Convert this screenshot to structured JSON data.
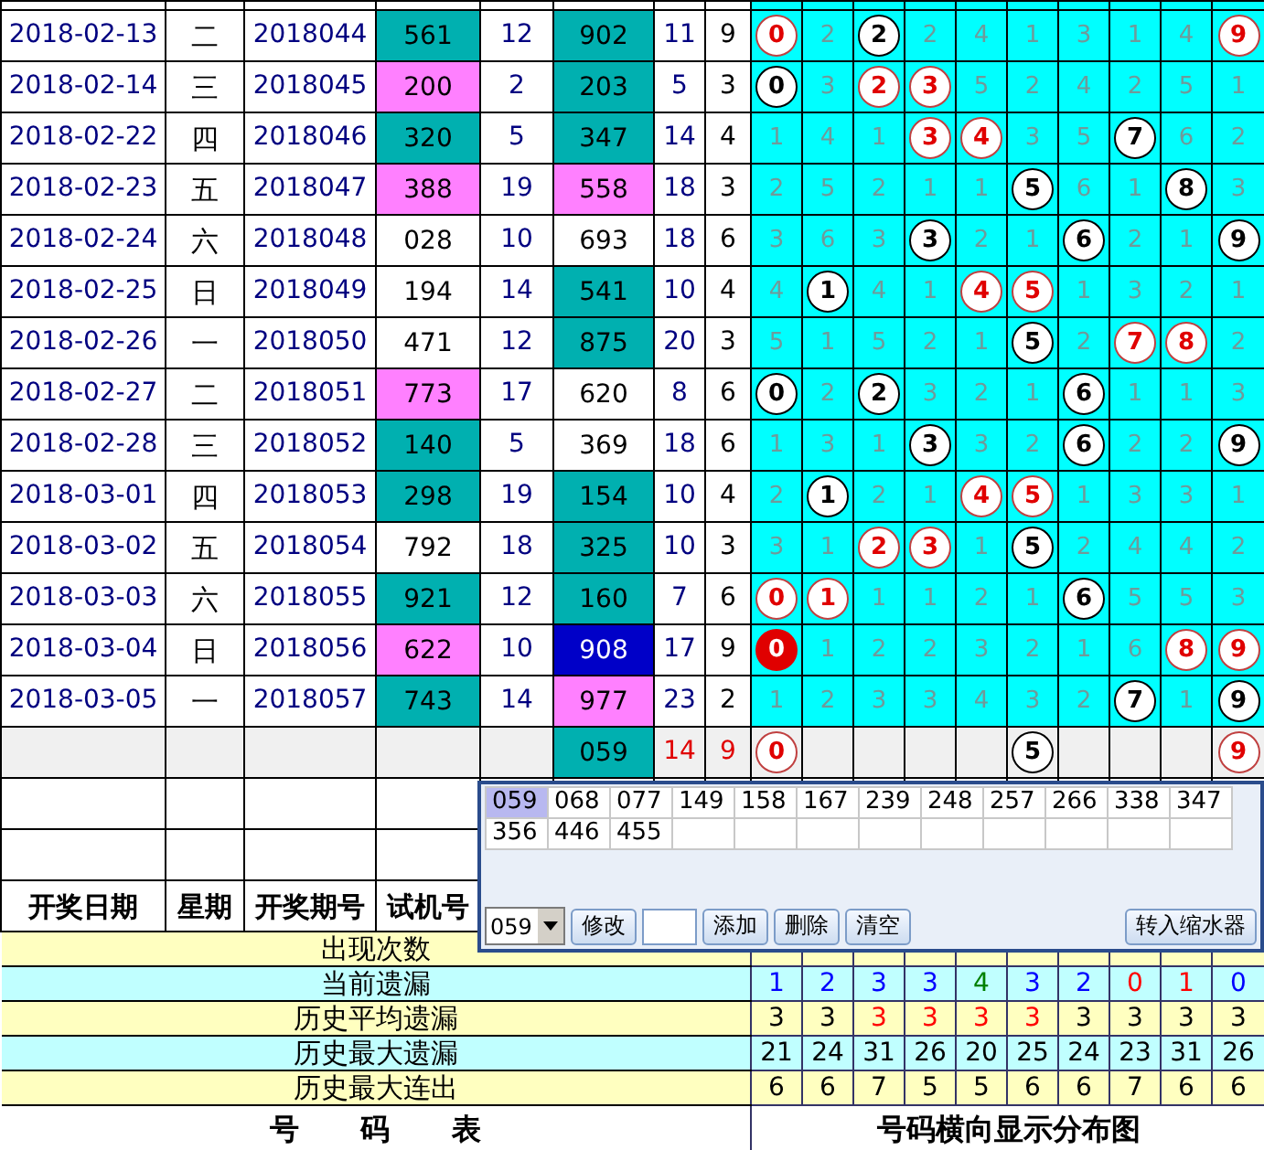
{
  "rows": [
    {
      "date": "2018-02-13",
      "weekday": "二",
      "issue": "2018044",
      "trial": {
        "text": "561",
        "color": "#00b0b0"
      },
      "trial_sum": "12",
      "result": {
        "text": "902",
        "color": "#00b0b0",
        "selected": false
      },
      "result_sum": "11",
      "span": "9",
      "cells": [
        {
          "text": "0",
          "kind": "hot"
        },
        {
          "text": "2",
          "kind": "miss"
        },
        {
          "text": "2",
          "kind": "hit"
        },
        {
          "text": "2",
          "kind": "miss"
        },
        {
          "text": "4",
          "kind": "miss"
        },
        {
          "text": "1",
          "kind": "miss"
        },
        {
          "text": "3",
          "kind": "miss"
        },
        {
          "text": "1",
          "kind": "miss"
        },
        {
          "text": "4",
          "kind": "miss"
        },
        {
          "text": "9",
          "kind": "hot"
        }
      ]
    },
    {
      "date": "2018-02-14",
      "weekday": "三",
      "issue": "2018045",
      "trial": {
        "text": "200",
        "color": "#ff80ff"
      },
      "trial_sum": "2",
      "result": {
        "text": "203",
        "color": "#00b0b0",
        "selected": false
      },
      "result_sum": "5",
      "span": "3",
      "cells": [
        {
          "text": "0",
          "kind": "hit"
        },
        {
          "text": "3",
          "kind": "miss"
        },
        {
          "text": "2",
          "kind": "hot"
        },
        {
          "text": "3",
          "kind": "hot"
        },
        {
          "text": "5",
          "kind": "miss"
        },
        {
          "text": "2",
          "kind": "miss"
        },
        {
          "text": "4",
          "kind": "miss"
        },
        {
          "text": "2",
          "kind": "miss"
        },
        {
          "text": "5",
          "kind": "miss"
        },
        {
          "text": "1",
          "kind": "miss"
        }
      ]
    },
    {
      "date": "2018-02-22",
      "weekday": "四",
      "issue": "2018046",
      "trial": {
        "text": "320",
        "color": "#00b0b0"
      },
      "trial_sum": "5",
      "result": {
        "text": "347",
        "color": "#00b0b0",
        "selected": false
      },
      "result_sum": "14",
      "span": "4",
      "cells": [
        {
          "text": "1",
          "kind": "miss"
        },
        {
          "text": "4",
          "kind": "miss"
        },
        {
          "text": "1",
          "kind": "miss"
        },
        {
          "text": "3",
          "kind": "hot"
        },
        {
          "text": "4",
          "kind": "hot"
        },
        {
          "text": "3",
          "kind": "miss"
        },
        {
          "text": "5",
          "kind": "miss"
        },
        {
          "text": "7",
          "kind": "hit"
        },
        {
          "text": "6",
          "kind": "miss"
        },
        {
          "text": "2",
          "kind": "miss"
        }
      ]
    },
    {
      "date": "2018-02-23",
      "weekday": "五",
      "issue": "2018047",
      "trial": {
        "text": "388",
        "color": "#ff80ff"
      },
      "trial_sum": "19",
      "result": {
        "text": "558",
        "color": "#ff80ff",
        "selected": false
      },
      "result_sum": "18",
      "span": "3",
      "cells": [
        {
          "text": "2",
          "kind": "miss"
        },
        {
          "text": "5",
          "kind": "miss"
        },
        {
          "text": "2",
          "kind": "miss"
        },
        {
          "text": "1",
          "kind": "miss"
        },
        {
          "text": "1",
          "kind": "miss"
        },
        {
          "text": "5",
          "kind": "hit"
        },
        {
          "text": "6",
          "kind": "miss"
        },
        {
          "text": "1",
          "kind": "miss"
        },
        {
          "text": "8",
          "kind": "hit"
        },
        {
          "text": "3",
          "kind": "miss"
        }
      ]
    },
    {
      "date": "2018-02-24",
      "weekday": "六",
      "issue": "2018048",
      "trial": {
        "text": "028"
      },
      "trial_sum": "10",
      "result": {
        "text": "693",
        "selected": false
      },
      "result_sum": "18",
      "span": "6",
      "cells": [
        {
          "text": "3",
          "kind": "miss"
        },
        {
          "text": "6",
          "kind": "miss"
        },
        {
          "text": "3",
          "kind": "miss"
        },
        {
          "text": "3",
          "kind": "hit"
        },
        {
          "text": "2",
          "kind": "miss"
        },
        {
          "text": "1",
          "kind": "miss"
        },
        {
          "text": "6",
          "kind": "hit"
        },
        {
          "text": "2",
          "kind": "miss"
        },
        {
          "text": "1",
          "kind": "miss"
        },
        {
          "text": "9",
          "kind": "hit"
        }
      ]
    },
    {
      "date": "2018-02-25",
      "weekday": "日",
      "issue": "2018049",
      "trial": {
        "text": "194"
      },
      "trial_sum": "14",
      "result": {
        "text": "541",
        "color": "#00b0b0",
        "selected": false
      },
      "result_sum": "10",
      "span": "4",
      "cells": [
        {
          "text": "4",
          "kind": "miss"
        },
        {
          "text": "1",
          "kind": "hit"
        },
        {
          "text": "4",
          "kind": "miss"
        },
        {
          "text": "1",
          "kind": "miss"
        },
        {
          "text": "4",
          "kind": "hot"
        },
        {
          "text": "5",
          "kind": "hot"
        },
        {
          "text": "1",
          "kind": "miss"
        },
        {
          "text": "3",
          "kind": "miss"
        },
        {
          "text": "2",
          "kind": "miss"
        },
        {
          "text": "1",
          "kind": "miss"
        }
      ]
    },
    {
      "date": "2018-02-26",
      "weekday": "一",
      "issue": "2018050",
      "trial": {
        "text": "471"
      },
      "trial_sum": "12",
      "result": {
        "text": "875",
        "color": "#00b0b0",
        "selected": false
      },
      "result_sum": "20",
      "span": "3",
      "cells": [
        {
          "text": "5",
          "kind": "miss"
        },
        {
          "text": "1",
          "kind": "miss"
        },
        {
          "text": "5",
          "kind": "miss"
        },
        {
          "text": "2",
          "kind": "miss"
        },
        {
          "text": "1",
          "kind": "miss"
        },
        {
          "text": "5",
          "kind": "hit"
        },
        {
          "text": "2",
          "kind": "miss"
        },
        {
          "text": "7",
          "kind": "hot"
        },
        {
          "text": "8",
          "kind": "hot"
        },
        {
          "text": "2",
          "kind": "miss"
        }
      ]
    },
    {
      "date": "2018-02-27",
      "weekday": "二",
      "issue": "2018051",
      "trial": {
        "text": "773",
        "color": "#ff80ff"
      },
      "trial_sum": "17",
      "result": {
        "text": "620",
        "selected": false
      },
      "result_sum": "8",
      "span": "6",
      "cells": [
        {
          "text": "0",
          "kind": "hit"
        },
        {
          "text": "2",
          "kind": "miss"
        },
        {
          "text": "2",
          "kind": "hit"
        },
        {
          "text": "3",
          "kind": "miss"
        },
        {
          "text": "2",
          "kind": "miss"
        },
        {
          "text": "1",
          "kind": "miss"
        },
        {
          "text": "6",
          "kind": "hit"
        },
        {
          "text": "1",
          "kind": "miss"
        },
        {
          "text": "1",
          "kind": "miss"
        },
        {
          "text": "3",
          "kind": "miss"
        }
      ]
    },
    {
      "date": "2018-02-28",
      "weekday": "三",
      "issue": "2018052",
      "trial": {
        "text": "140",
        "color": "#00b0b0"
      },
      "trial_sum": "5",
      "result": {
        "text": "369",
        "selected": false
      },
      "result_sum": "18",
      "span": "6",
      "cells": [
        {
          "text": "1",
          "kind": "miss"
        },
        {
          "text": "3",
          "kind": "miss"
        },
        {
          "text": "1",
          "kind": "miss"
        },
        {
          "text": "3",
          "kind": "hit"
        },
        {
          "text": "3",
          "kind": "miss"
        },
        {
          "text": "2",
          "kind": "miss"
        },
        {
          "text": "6",
          "kind": "hit"
        },
        {
          "text": "2",
          "kind": "miss"
        },
        {
          "text": "2",
          "kind": "miss"
        },
        {
          "text": "9",
          "kind": "hit"
        }
      ]
    },
    {
      "date": "2018-03-01",
      "weekday": "四",
      "issue": "2018053",
      "trial": {
        "text": "298",
        "color": "#00b0b0"
      },
      "trial_sum": "19",
      "result": {
        "text": "154",
        "color": "#00b0b0",
        "selected": false
      },
      "result_sum": "10",
      "span": "4",
      "cells": [
        {
          "text": "2",
          "kind": "miss"
        },
        {
          "text": "1",
          "kind": "hit"
        },
        {
          "text": "2",
          "kind": "miss"
        },
        {
          "text": "1",
          "kind": "miss"
        },
        {
          "text": "4",
          "kind": "hot"
        },
        {
          "text": "5",
          "kind": "hot"
        },
        {
          "text": "1",
          "kind": "miss"
        },
        {
          "text": "3",
          "kind": "miss"
        },
        {
          "text": "3",
          "kind": "miss"
        },
        {
          "text": "1",
          "kind": "miss"
        }
      ]
    },
    {
      "date": "2018-03-02",
      "weekday": "五",
      "issue": "2018054",
      "trial": {
        "text": "792"
      },
      "trial_sum": "18",
      "result": {
        "text": "325",
        "color": "#00b0b0",
        "selected": false
      },
      "result_sum": "10",
      "span": "3",
      "cells": [
        {
          "text": "3",
          "kind": "miss"
        },
        {
          "text": "1",
          "kind": "miss"
        },
        {
          "text": "2",
          "kind": "hot"
        },
        {
          "text": "3",
          "kind": "hot"
        },
        {
          "text": "1",
          "kind": "miss"
        },
        {
          "text": "5",
          "kind": "hit"
        },
        {
          "text": "2",
          "kind": "miss"
        },
        {
          "text": "4",
          "kind": "miss"
        },
        {
          "text": "4",
          "kind": "miss"
        },
        {
          "text": "2",
          "kind": "miss"
        }
      ]
    },
    {
      "date": "2018-03-03",
      "weekday": "六",
      "issue": "2018055",
      "trial": {
        "text": "921",
        "color": "#00b0b0"
      },
      "trial_sum": "12",
      "result": {
        "text": "160",
        "color": "#00b0b0",
        "selected": false
      },
      "result_sum": "7",
      "span": "6",
      "cells": [
        {
          "text": "0",
          "kind": "hot"
        },
        {
          "text": "1",
          "kind": "hot"
        },
        {
          "text": "1",
          "kind": "miss"
        },
        {
          "text": "1",
          "kind": "miss"
        },
        {
          "text": "2",
          "kind": "miss"
        },
        {
          "text": "1",
          "kind": "miss"
        },
        {
          "text": "6",
          "kind": "hit"
        },
        {
          "text": "5",
          "kind": "miss"
        },
        {
          "text": "5",
          "kind": "miss"
        },
        {
          "text": "3",
          "kind": "miss"
        }
      ]
    },
    {
      "date": "2018-03-04",
      "weekday": "日",
      "issue": "2018056",
      "trial": {
        "text": "622",
        "color": "#ff80ff"
      },
      "trial_sum": "10",
      "result": {
        "text": "908",
        "selected": true
      },
      "result_sum": "17",
      "span": "9",
      "cells": [
        {
          "text": "0",
          "kind": "lead"
        },
        {
          "text": "1",
          "kind": "miss"
        },
        {
          "text": "2",
          "kind": "miss"
        },
        {
          "text": "2",
          "kind": "miss"
        },
        {
          "text": "3",
          "kind": "miss"
        },
        {
          "text": "2",
          "kind": "miss"
        },
        {
          "text": "1",
          "kind": "miss"
        },
        {
          "text": "6",
          "kind": "miss"
        },
        {
          "text": "8",
          "kind": "hot"
        },
        {
          "text": "9",
          "kind": "hot"
        }
      ]
    },
    {
      "date": "2018-03-05",
      "weekday": "一",
      "issue": "2018057",
      "trial": {
        "text": "743",
        "color": "#00b0b0"
      },
      "trial_sum": "14",
      "result": {
        "text": "977",
        "color": "#ff80ff",
        "selected": false
      },
      "result_sum": "23",
      "span": "2",
      "cells": [
        {
          "text": "1",
          "kind": "miss"
        },
        {
          "text": "2",
          "kind": "miss"
        },
        {
          "text": "3",
          "kind": "miss"
        },
        {
          "text": "3",
          "kind": "miss"
        },
        {
          "text": "4",
          "kind": "miss"
        },
        {
          "text": "3",
          "kind": "miss"
        },
        {
          "text": "2",
          "kind": "miss"
        },
        {
          "text": "7",
          "kind": "hit"
        },
        {
          "text": "1",
          "kind": "miss"
        },
        {
          "text": "9",
          "kind": "hit"
        }
      ]
    }
  ],
  "summary": {
    "result": {
      "text": "059",
      "color": "#00b0b0"
    },
    "result_sum": "14",
    "span": "9",
    "cells": [
      {
        "text": "0",
        "kind": "hot"
      },
      {
        "kind": "blank"
      },
      {
        "kind": "blank"
      },
      {
        "kind": "blank"
      },
      {
        "kind": "blank"
      },
      {
        "text": "5",
        "kind": "hit"
      },
      {
        "kind": "blank"
      },
      {
        "kind": "blank"
      },
      {
        "kind": "blank"
      },
      {
        "text": "9",
        "kind": "hot"
      }
    ]
  },
  "header": [
    "开奖日期",
    "星期",
    "开奖期号",
    "试机号"
  ],
  "stats": [
    {
      "label": "出现次数"
    },
    {
      "label": "当前遗漏",
      "values": [
        {
          "text": "1",
          "color": "#0000ff"
        },
        {
          "text": "2",
          "color": "#0000ff"
        },
        {
          "text": "3",
          "color": "#0000ff"
        },
        {
          "text": "3",
          "color": "#0000ff"
        },
        {
          "text": "4",
          "color": "#008000"
        },
        {
          "text": "3",
          "color": "#0000ff"
        },
        {
          "text": "2",
          "color": "#0000ff"
        },
        {
          "text": "0",
          "color": "#ff0000"
        },
        {
          "text": "1",
          "color": "#ff0000"
        },
        {
          "text": "0",
          "color": "#0000ff"
        }
      ]
    },
    {
      "label": "历史平均遗漏",
      "values": [
        {
          "text": "3",
          "color": "#000000"
        },
        {
          "text": "3",
          "color": "#000000"
        },
        {
          "text": "3",
          "color": "#ff0000"
        },
        {
          "text": "3",
          "color": "#ff0000"
        },
        {
          "text": "3",
          "color": "#ff0000"
        },
        {
          "text": "3",
          "color": "#ff0000"
        },
        {
          "text": "3",
          "color": "#000000"
        },
        {
          "text": "3",
          "color": "#000000"
        },
        {
          "text": "3",
          "color": "#000000"
        },
        {
          "text": "3",
          "color": "#000000"
        }
      ]
    },
    {
      "label": "历史最大遗漏",
      "values": [
        {
          "text": "21"
        },
        {
          "text": "24"
        },
        {
          "text": "31"
        },
        {
          "text": "26"
        },
        {
          "text": "20"
        },
        {
          "text": "25"
        },
        {
          "text": "24"
        },
        {
          "text": "23"
        },
        {
          "text": "31"
        },
        {
          "text": "26"
        }
      ]
    },
    {
      "label": "历史最大连出",
      "values": [
        {
          "text": "6"
        },
        {
          "text": "6"
        },
        {
          "text": "7"
        },
        {
          "text": "5"
        },
        {
          "text": "5"
        },
        {
          "text": "6"
        },
        {
          "text": "6"
        },
        {
          "text": "7"
        },
        {
          "text": "6"
        },
        {
          "text": "6"
        }
      ]
    }
  ],
  "footer": {
    "left": "号 码 表",
    "right": "号码横向显示分布图"
  },
  "popup": {
    "numbers": [
      {
        "text": "059",
        "selected": true
      },
      {
        "text": "068",
        "selected": false
      },
      {
        "text": "077",
        "selected": false
      },
      {
        "text": "149",
        "selected": false
      },
      {
        "text": "158",
        "selected": false
      },
      {
        "text": "167",
        "selected": false
      },
      {
        "text": "239",
        "selected": false
      },
      {
        "text": "248",
        "selected": false
      },
      {
        "text": "257",
        "selected": false
      },
      {
        "text": "266",
        "selected": false
      },
      {
        "text": "338",
        "selected": false
      },
      {
        "text": "347",
        "selected": false
      },
      {
        "text": "356",
        "selected": false
      },
      {
        "text": "446",
        "selected": false
      },
      {
        "text": "455",
        "selected": false
      }
    ],
    "select_value": "059",
    "edit_button": "修改",
    "add_button": "添加",
    "delete_button": "删除",
    "clear_button": "清空",
    "transfer_button": "转入缩水器"
  }
}
